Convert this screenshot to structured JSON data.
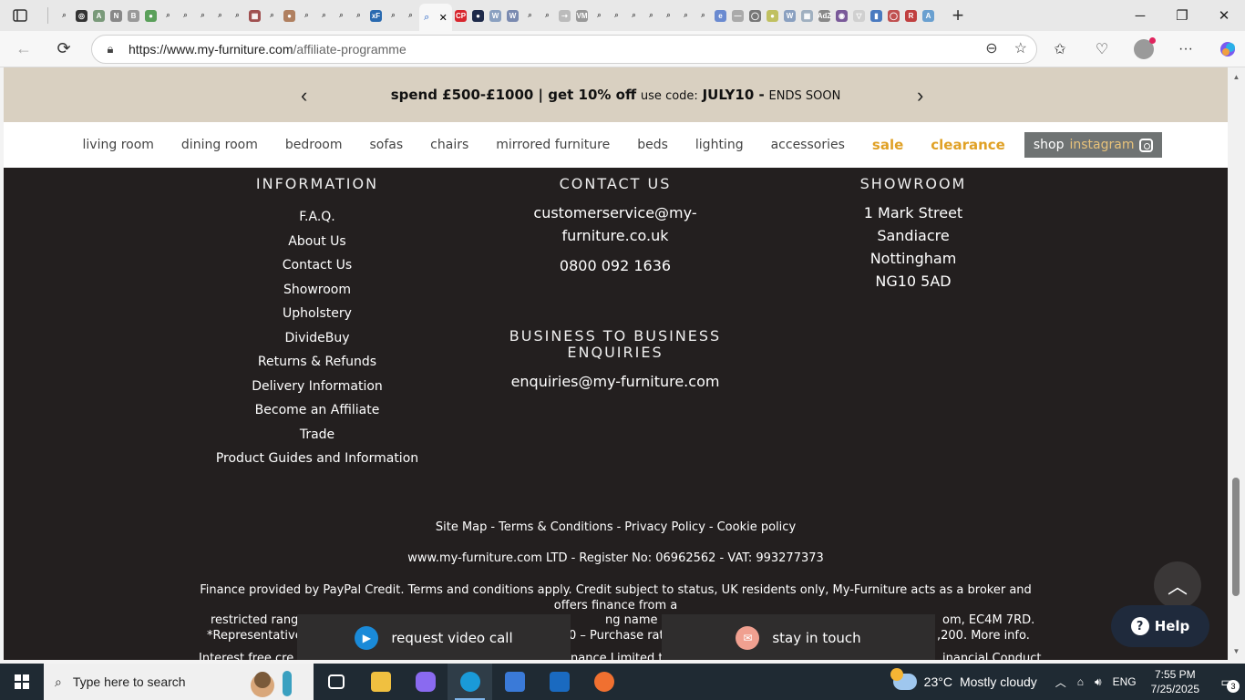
{
  "browser": {
    "url_host": "https://www.my-furniture.com",
    "url_path": "/affiliate-programme",
    "active_tab_close": "✕",
    "new_tab": "+",
    "tab_favicons": [
      {
        "glyph": "⌕",
        "color": "#e8e8e8"
      },
      {
        "glyph": "◎",
        "color": "#333333"
      },
      {
        "glyph": "A",
        "color": "#7a9a7a"
      },
      {
        "glyph": "N",
        "color": "#888888"
      },
      {
        "glyph": "B",
        "color": "#999999"
      },
      {
        "glyph": "●",
        "color": "#5aa05a"
      },
      {
        "glyph": "⌕",
        "color": "#e8e8e8"
      },
      {
        "glyph": "⌕",
        "color": "#e8e8e8"
      },
      {
        "glyph": "⌕",
        "color": "#e8e8e8"
      },
      {
        "glyph": "⌕",
        "color": "#e8e8e8"
      },
      {
        "glyph": "⌕",
        "color": "#e8e8e8"
      },
      {
        "glyph": "▦",
        "color": "#a05050"
      },
      {
        "glyph": "⌕",
        "color": "#e8e8e8"
      },
      {
        "glyph": "●",
        "color": "#b08060"
      },
      {
        "glyph": "⌕",
        "color": "#e8e8e8"
      },
      {
        "glyph": "⌕",
        "color": "#e8e8e8"
      },
      {
        "glyph": "⌕",
        "color": "#e8e8e8"
      },
      {
        "glyph": "⌕",
        "color": "#e8e8e8"
      },
      {
        "glyph": "xF",
        "color": "#2a6ab0"
      },
      {
        "glyph": "⌕",
        "color": "#e8e8e8"
      },
      {
        "glyph": "⌕",
        "color": "#e8e8e8"
      }
    ],
    "tab_favicons_after": [
      {
        "glyph": "CP",
        "color": "#d8262e"
      },
      {
        "glyph": "●",
        "color": "#1e2a4a"
      },
      {
        "glyph": "W",
        "color": "#8aa0c0"
      },
      {
        "glyph": "W",
        "color": "#7a8ab0"
      },
      {
        "glyph": "⌕",
        "color": "#e8e8e8"
      },
      {
        "glyph": "⌕",
        "color": "#e8e8e8"
      },
      {
        "glyph": "⇢",
        "color": "#bbbbbb"
      },
      {
        "glyph": "VM",
        "color": "#999999"
      },
      {
        "glyph": "⌕",
        "color": "#e8e8e8"
      },
      {
        "glyph": "⌕",
        "color": "#e8e8e8"
      },
      {
        "glyph": "⌕",
        "color": "#e8e8e8"
      },
      {
        "glyph": "⌕",
        "color": "#e8e8e8"
      },
      {
        "glyph": "⌕",
        "color": "#e8e8e8"
      },
      {
        "glyph": "⌕",
        "color": "#e8e8e8"
      },
      {
        "glyph": "⌕",
        "color": "#e8e8e8"
      },
      {
        "glyph": "e",
        "color": "#6a8ad0"
      },
      {
        "glyph": "—",
        "color": "#aaaaaa"
      },
      {
        "glyph": "◯",
        "color": "#777777"
      },
      {
        "glyph": "●",
        "color": "#c0c060"
      },
      {
        "glyph": "W",
        "color": "#8aa0c0"
      },
      {
        "glyph": "▦",
        "color": "#a0b0c0"
      },
      {
        "glyph": "AdZ",
        "color": "#888888"
      },
      {
        "glyph": "◉",
        "color": "#7a5a9a"
      },
      {
        "glyph": "▽",
        "color": "#d0d0d0"
      },
      {
        "glyph": "▮",
        "color": "#4a7ac0"
      },
      {
        "glyph": "◯",
        "color": "#c05050"
      },
      {
        "glyph": "R",
        "color": "#c04040"
      },
      {
        "glyph": "A",
        "color": "#6aa0d0"
      }
    ]
  },
  "page": {
    "promo": {
      "bold": "spend £500-£1000 | get 10% off",
      "code_label": "use code:",
      "code": "JULY10 -",
      "ends": "ENDS SOON"
    },
    "nav": [
      "living room",
      "dining room",
      "bedroom",
      "sofas",
      "chairs",
      "mirrored furniture",
      "beds",
      "lighting",
      "accessories"
    ],
    "nav_hot": [
      "sale",
      "clearance"
    ],
    "instagram": {
      "prefix": "shop",
      "brand": "instagram"
    },
    "information": {
      "heading": "INFORMATION",
      "links": [
        "F.A.Q.",
        "About Us",
        "Contact Us",
        "Showroom",
        "Upholstery",
        "DivideBuy",
        "Returns & Refunds",
        "Delivery Information",
        "Become an Affiliate",
        "Trade",
        "Product Guides and Information"
      ]
    },
    "contact": {
      "heading": "CONTACT US",
      "email_line1": "customerservice@my-",
      "email_line2": "furniture.co.uk",
      "phone": "0800 092 1636",
      "b2b_heading_line1": "BUSINESS TO BUSINESS",
      "b2b_heading_line2": "ENQUIRIES",
      "b2b_email": "enquiries@my-furniture.com"
    },
    "showroom": {
      "heading": "SHOWROOM",
      "lines": [
        "1 Mark Street",
        "Sandiacre",
        "Nottingham",
        "NG10 5AD"
      ]
    },
    "legal_links": [
      "Site Map",
      "Terms & Conditions",
      "Privacy Policy",
      "Cookie policy"
    ],
    "legal_sep": "-",
    "company_line": "www.my-furniture.com LTD - Register No: 06962562 - VAT: 993277373",
    "finance_line1": "Finance provided by PayPal Credit. Terms and conditions apply. Credit subject to status, UK residents only, My-Furniture acts as a broker and",
    "finance_line2": "offers finance from a",
    "finance_line3_left": "restricted rang",
    "finance_line3_mid": "ng name of PayP",
    "finance_line3_right": "om, EC4M 7RD.",
    "finance_line4_left": "*Representative",
    "finance_line4_mid": "0 – Purchase rat",
    "finance_line4_right": ",200. More info.",
    "finance_line5_left": "Interest free cre",
    "finance_line5_mid": "nance Limited t",
    "finance_line5_right": "inancial Conduct",
    "cta_video": "request video call",
    "cta_touch": "stay in touch",
    "help": "Help",
    "to_top": "︿"
  },
  "taskbar": {
    "search_placeholder": "Type here to search",
    "weather_temp": "23°C",
    "weather_desc": "Mostly cloudy",
    "lang": "ENG",
    "time": "7:55 PM",
    "date": "7/25/2025",
    "notifications": "3",
    "weather_badge": "1"
  },
  "colors": {
    "promo_bg": "#d9d0c1",
    "footer_bg": "#231f1f",
    "accent_hot": "#e0a126",
    "instagram_bg": "#6f7373"
  }
}
